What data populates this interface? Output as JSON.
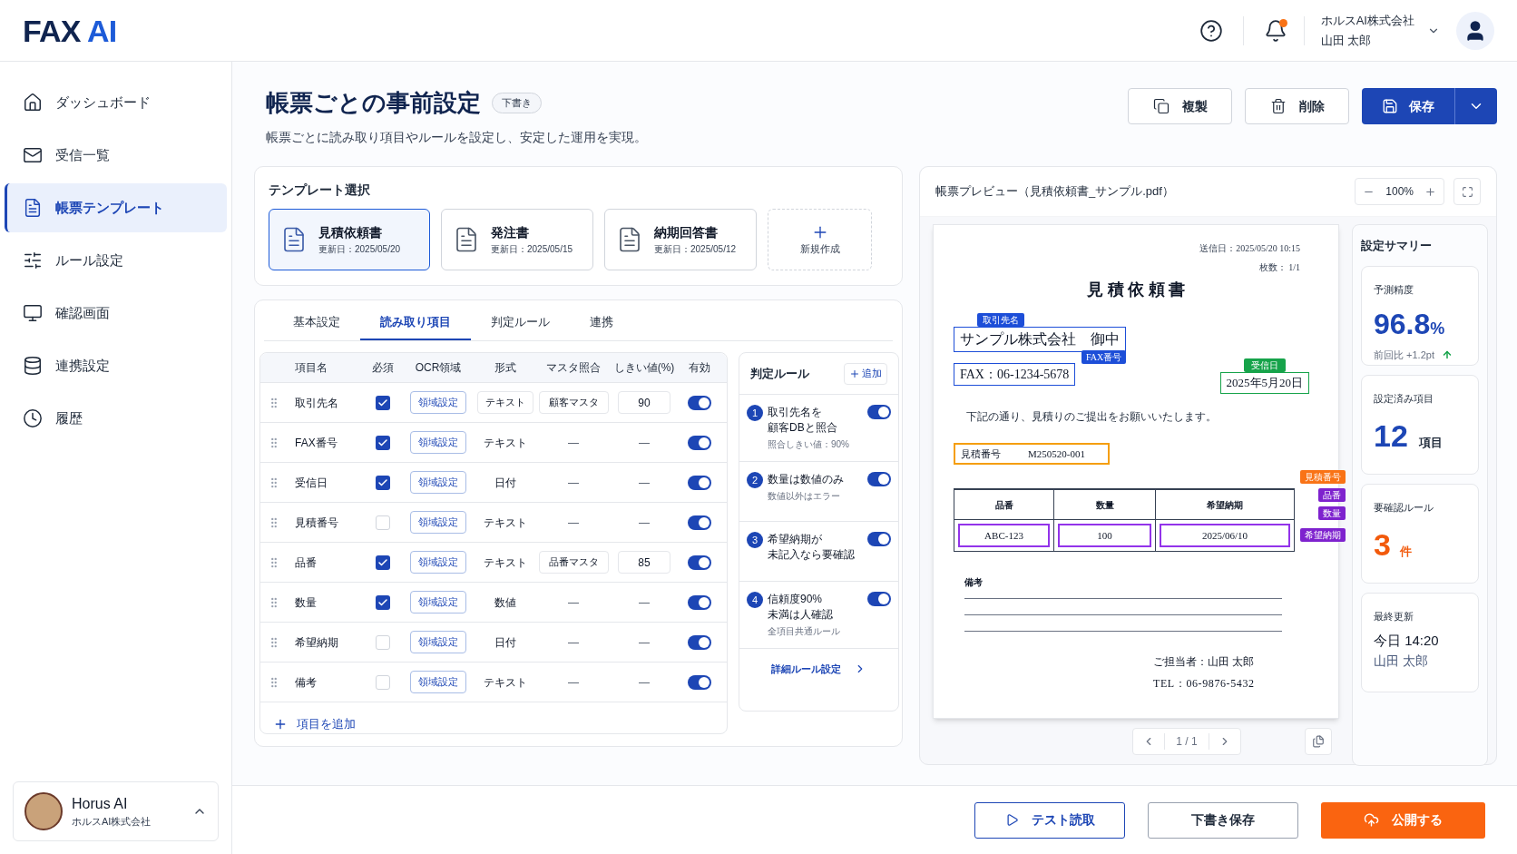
{
  "header": {
    "logo": "FAX",
    "logo_accent": "AI",
    "company": "ホルスAI株式会社",
    "user": "山田 太郎"
  },
  "sidebar": {
    "items": [
      {
        "label": "ダッシュボード",
        "selected": false
      },
      {
        "label": "受信一覧",
        "selected": false
      },
      {
        "label": "帳票テンプレート",
        "selected": true
      },
      {
        "label": "ルール設定",
        "selected": false
      },
      {
        "label": "確認画面",
        "selected": false
      },
      {
        "label": "連携設定",
        "selected": false
      },
      {
        "label": "履歴",
        "selected": false
      }
    ],
    "account": {
      "name": "Horus AI",
      "company": "ホルスAI株式会社"
    }
  },
  "page": {
    "title": "帳票ごとの事前設定",
    "badge": "下書き",
    "subtitle": "帳票ごとに読み取り項目やルールを設定し、安定した運用を実現。",
    "actions": [
      {
        "label": "複製",
        "kind": "outline"
      },
      {
        "label": "削除",
        "kind": "outline"
      },
      {
        "label": "保存",
        "kind": "primary"
      }
    ]
  },
  "template_select": {
    "title": "テンプレート選択",
    "templates": [
      {
        "name": "見積依頼書",
        "updated": "更新日：2025/05/20",
        "selected": true
      },
      {
        "name": "発注書",
        "updated": "更新日：2025/05/15",
        "selected": false
      },
      {
        "name": "納期回答書",
        "updated": "更新日：2025/05/12",
        "selected": false
      }
    ],
    "new_label": "新規作成"
  },
  "tabs": [
    {
      "label": "基本設定",
      "selected": false
    },
    {
      "label": "読み取り項目",
      "selected": true
    },
    {
      "label": "判定ルール",
      "selected": false
    },
    {
      "label": "連携",
      "selected": false
    }
  ],
  "fields_table": {
    "columns": [
      "項目名",
      "必須",
      "OCR領域",
      "形式",
      "マスタ照合",
      "しきい値(%)",
      "有効"
    ],
    "rows": [
      {
        "name": "取引先名",
        "required": true,
        "region": "領域設定",
        "format": {
          "value": "テキスト",
          "kind": "select"
        },
        "master": {
          "value": "顧客マスタ",
          "kind": "select"
        },
        "threshold": {
          "value": "90",
          "kind": "input"
        },
        "enabled": true
      },
      {
        "name": "FAX番号",
        "required": true,
        "region": "領域設定",
        "format": {
          "value": "テキスト",
          "kind": "plain"
        },
        "master": {
          "value": "—",
          "kind": "empty"
        },
        "threshold": {
          "value": "—",
          "kind": "empty"
        },
        "enabled": true
      },
      {
        "name": "受信日",
        "required": true,
        "region": "領域設定",
        "format": {
          "value": "日付",
          "kind": "plain"
        },
        "master": {
          "value": "—",
          "kind": "empty"
        },
        "threshold": {
          "value": "—",
          "kind": "empty"
        },
        "enabled": true
      },
      {
        "name": "見積番号",
        "required": false,
        "region": "領域設定",
        "format": {
          "value": "テキスト",
          "kind": "plain"
        },
        "master": {
          "value": "—",
          "kind": "empty"
        },
        "threshold": {
          "value": "—",
          "kind": "empty"
        },
        "enabled": true
      },
      {
        "name": "品番",
        "required": true,
        "region": "領域設定",
        "format": {
          "value": "テキスト",
          "kind": "plain"
        },
        "master": {
          "value": "品番マスタ",
          "kind": "select"
        },
        "threshold": {
          "value": "85",
          "kind": "input"
        },
        "enabled": true
      },
      {
        "name": "数量",
        "required": true,
        "region": "領域設定",
        "format": {
          "value": "数値",
          "kind": "plain"
        },
        "master": {
          "value": "—",
          "kind": "empty"
        },
        "threshold": {
          "value": "—",
          "kind": "empty"
        },
        "enabled": true
      },
      {
        "name": "希望納期",
        "required": false,
        "region": "領域設定",
        "format": {
          "value": "日付",
          "kind": "plain"
        },
        "master": {
          "value": "—",
          "kind": "empty"
        },
        "threshold": {
          "value": "—",
          "kind": "empty"
        },
        "enabled": true
      },
      {
        "name": "備考",
        "required": false,
        "region": "領域設定",
        "format": {
          "value": "テキスト",
          "kind": "plain"
        },
        "master": {
          "value": "—",
          "kind": "empty"
        },
        "threshold": {
          "value": "—",
          "kind": "empty"
        },
        "enabled": true
      }
    ],
    "add_label": "項目を追加"
  },
  "rules": {
    "title": "判定ルール",
    "add_label": "追加",
    "items": [
      {
        "number": "1",
        "title_lines": [
          "取引先名を",
          "顧客DBと照合"
        ],
        "note": "照合しきい値：90%",
        "enabled": true
      },
      {
        "number": "2",
        "title_lines": [
          "数量は数値のみ"
        ],
        "note": "数値以外はエラー",
        "enabled": true
      },
      {
        "number": "3",
        "title_lines": [
          "希望納期が",
          "未記入なら要確認"
        ],
        "enabled": true
      },
      {
        "number": "4",
        "title_lines": [
          "信頼度90%",
          "未満は人確認"
        ],
        "note": "全項目共通ルール",
        "enabled": true
      }
    ],
    "detail_link": "詳細ルール設定"
  },
  "preview": {
    "title": "帳票プレビュー（見積依頼書_サンプル.pdf）",
    "zoom": "100%",
    "pager": "1 / 1",
    "document": {
      "sent": "送信日：2025/05/20 10:15",
      "pages": "枚数： 1/1",
      "title": "見 積 依 頼 書",
      "customer": {
        "value": "サンプル株式会社　御中",
        "tag": "取引先名",
        "color": "#1d4ed8"
      },
      "fax": {
        "value": "FAX：06-1234-5678",
        "tag": "FAX番号",
        "color": "#1d4ed8"
      },
      "received": {
        "value": "2025年5月20日",
        "tag": "受信日",
        "color": "#16a34a"
      },
      "message": "下記の通り、見積りのご提出をお願いいたします。",
      "quote": {
        "label": "見積番号",
        "value": "M250520-001",
        "color": "#f59e0b"
      },
      "table": {
        "columns": [
          "品番",
          "数量",
          "希望納期"
        ],
        "cells": [
          {
            "value": "ABC-123",
            "color": "#9333ea"
          },
          {
            "value": "100",
            "color": "#9333ea"
          },
          {
            "value": "2025/06/10",
            "color": "#9333ea"
          }
        ]
      },
      "side_tags": [
        {
          "label": "見積番号",
          "color": "#f97316"
        },
        {
          "label": "品番",
          "color": "#7e22ce"
        },
        {
          "label": "数量",
          "color": "#7e22ce"
        },
        {
          "label": "希望納期",
          "color": "#7e22ce"
        }
      ],
      "remarks": "備考",
      "contact": "ご担当者：山田 太郎",
      "tel": "TEL：06-9876-5432"
    }
  },
  "summary": {
    "title": "設定サマリー",
    "cards": [
      {
        "kind": "accuracy",
        "label": "予測精度",
        "value": "96.8",
        "unit": "%",
        "note": "前回比 +1.2pt"
      },
      {
        "kind": "count",
        "label": "設定済み項目",
        "value": "12",
        "unit": "項目"
      },
      {
        "kind": "warning",
        "label": "要確認ルール",
        "value": "3",
        "unit": "件"
      },
      {
        "kind": "updated",
        "label": "最終更新",
        "value": "今日 14:20",
        "note": "山田 太郎"
      }
    ]
  },
  "footer": {
    "buttons": [
      {
        "label": "テスト読取",
        "kind": "outline"
      },
      {
        "label": "下書き保存",
        "kind": "secondary"
      },
      {
        "label": "公開する",
        "kind": "publish"
      }
    ]
  }
}
